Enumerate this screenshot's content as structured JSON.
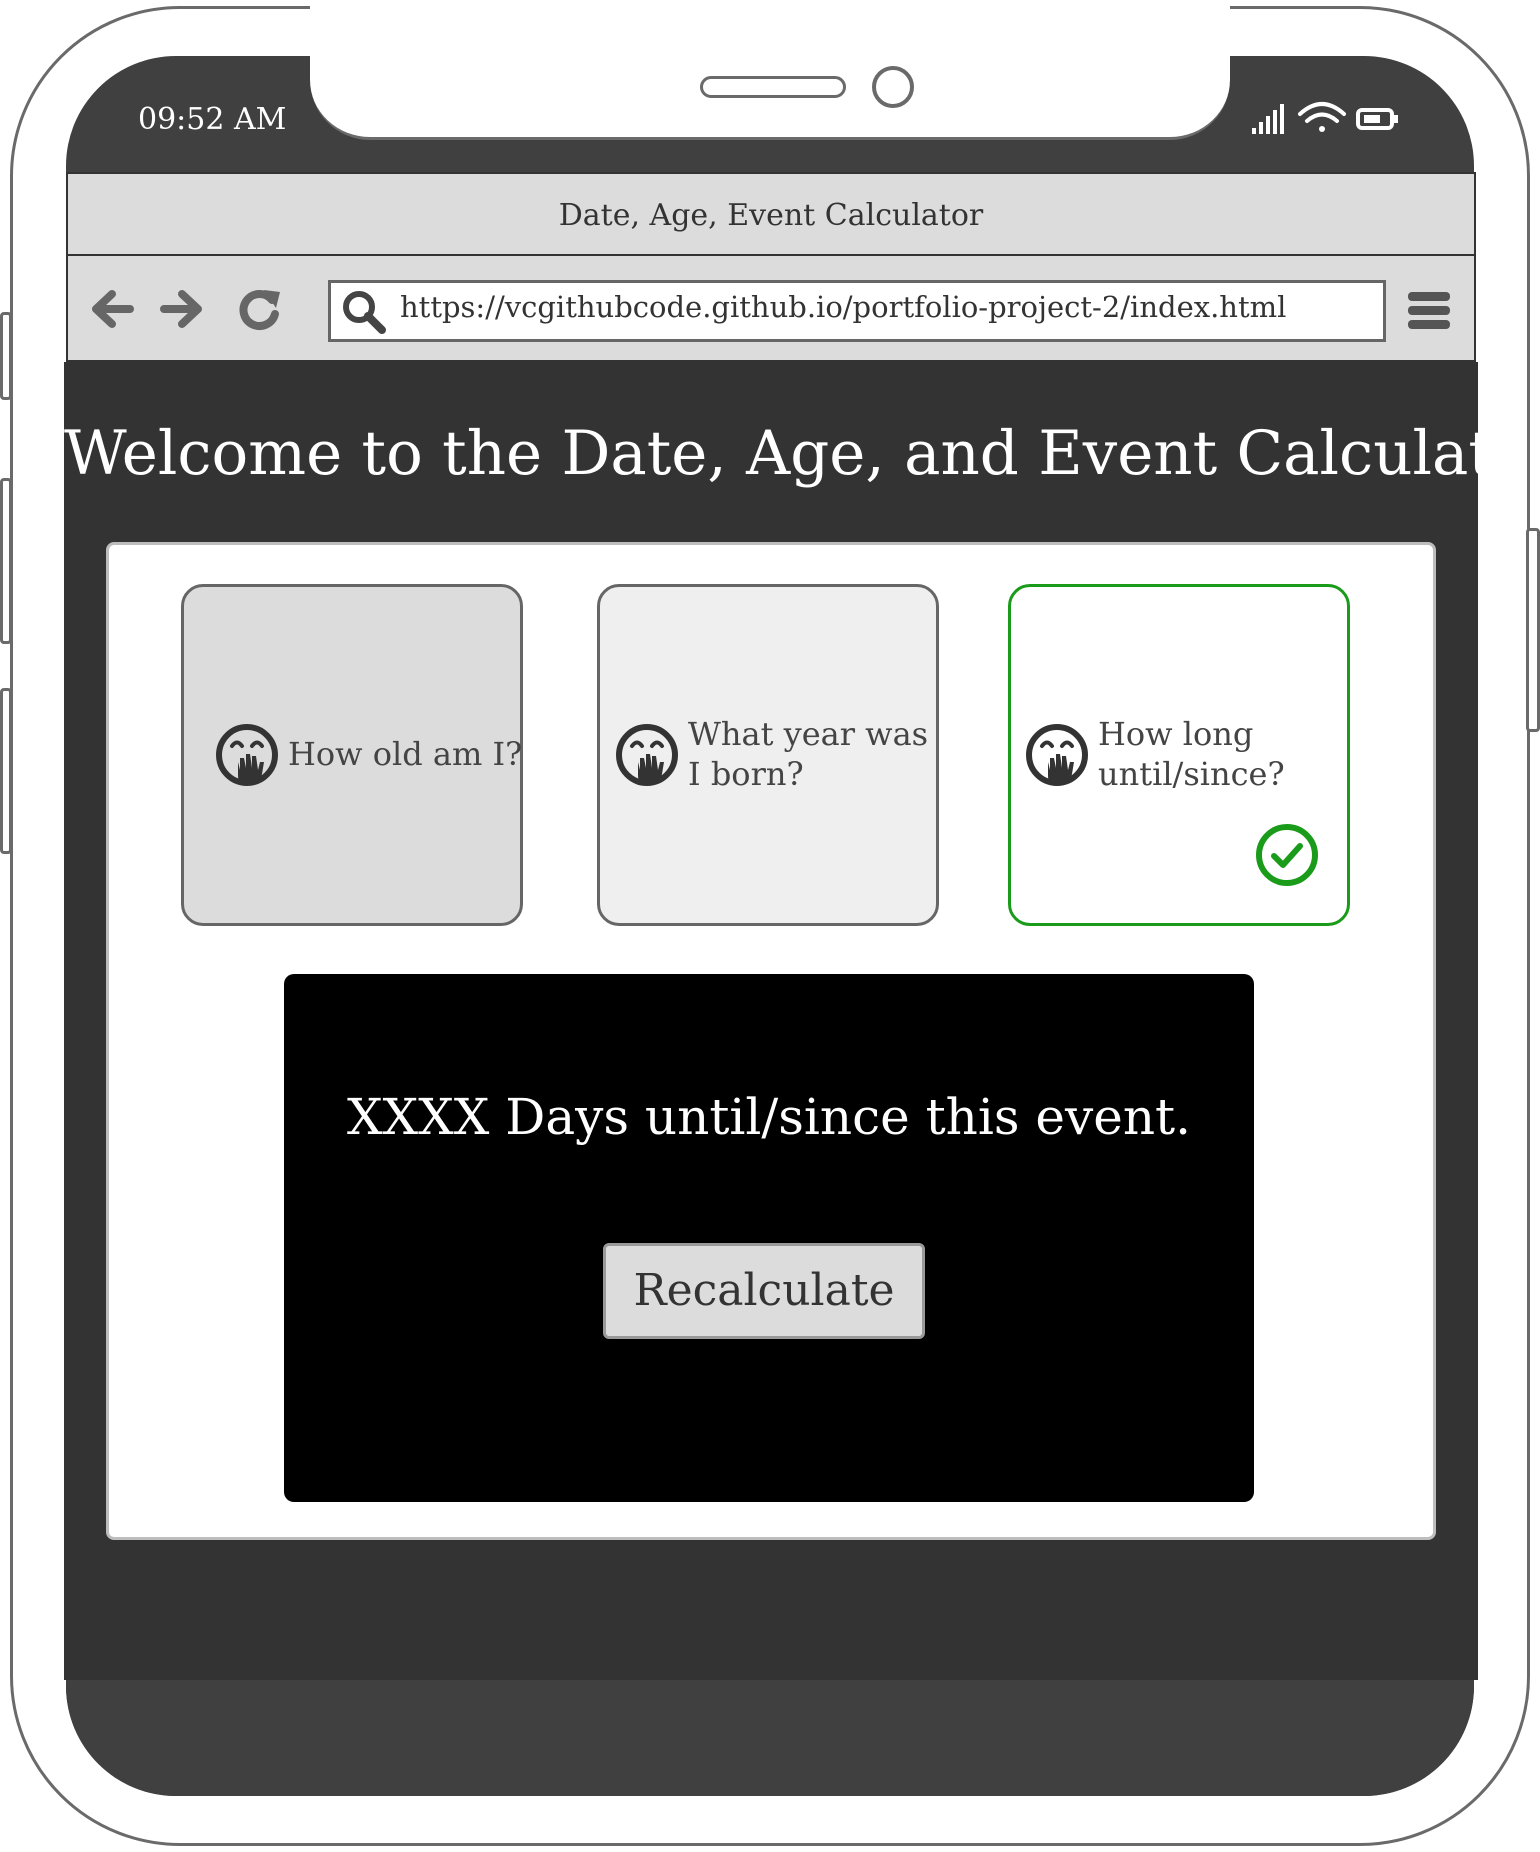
{
  "status_bar": {
    "time": "09:52 AM",
    "icons": [
      "signal-icon",
      "wifi-icon",
      "battery-icon"
    ]
  },
  "browser": {
    "tab_title": "Date, Age, Event Calculator",
    "url": "https://vcgithubcode.github.io/portfolio-project-2/index.html",
    "toolbar_icons": [
      "back-arrow-icon",
      "forward-arrow-icon",
      "reload-icon",
      "search-icon",
      "hamburger-menu-icon"
    ]
  },
  "page": {
    "heading": "Welcome to the Date, Age, and Event Calculator",
    "options": [
      {
        "label": "How old am I?",
        "icon": "laughing-emoji-icon",
        "selected": false
      },
      {
        "label": "What year was I born?",
        "icon": "laughing-emoji-icon",
        "selected": false
      },
      {
        "label": "How long until/since?",
        "icon": "laughing-emoji-icon",
        "selected": true
      }
    ],
    "result": {
      "text": "XXXX Days until/since this event.",
      "button_label": "Recalculate"
    }
  },
  "colors": {
    "selected_accent": "#1a9c1a",
    "page_background": "#333333",
    "result_background": "#000000",
    "option_1_bg": "#dcdcdc",
    "option_2_bg": "#efefef",
    "option_3_bg": "#ffffff"
  }
}
